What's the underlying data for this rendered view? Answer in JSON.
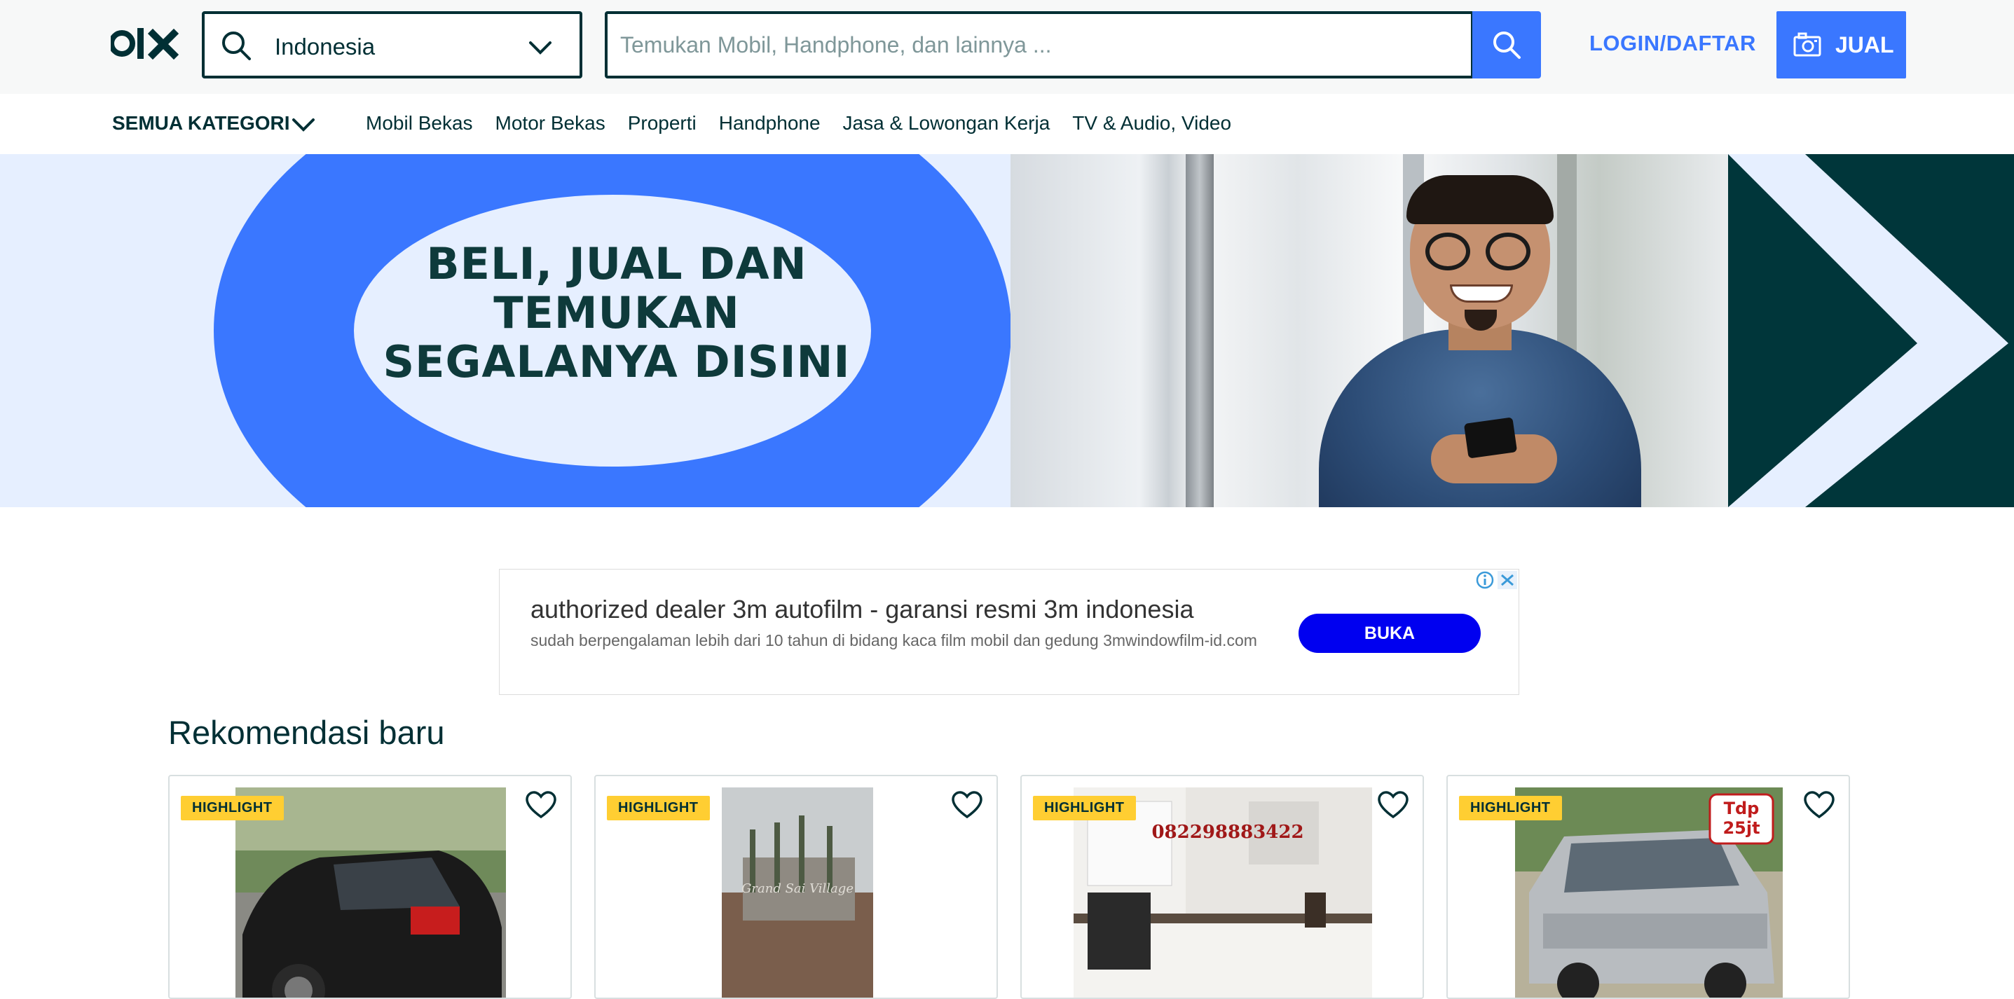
{
  "header": {
    "logo_alt": "olx",
    "location": "Indonesia",
    "search_placeholder": "Temukan Mobil, Handphone, dan lainnya ...",
    "login_label": "LOGIN/DAFTAR",
    "sell_label": "JUAL"
  },
  "categories": {
    "all_label": "SEMUA KATEGORI",
    "links": [
      "Mobil Bekas",
      "Motor Bekas",
      "Properti",
      "Handphone",
      "Jasa & Lowongan Kerja",
      "TV & Audio, Video"
    ]
  },
  "banner": {
    "headline_1": "BELI, JUAL DAN",
    "headline_2": "TEMUKAN",
    "headline_3": "SEGALANYA DISINI"
  },
  "ad": {
    "title": "authorized dealer 3m autofilm - garansi resmi 3m indonesia",
    "description": "sudah berpengalaman lebih dari 10 tahun di bidang kaca film mobil dan gedung 3mwindowfilm-id.com",
    "button": "BUKA"
  },
  "recommendations": {
    "title": "Rekomendasi baru",
    "cards": [
      {
        "badge": "HIGHLIGHT"
      },
      {
        "badge": "HIGHLIGHT",
        "image_text": "Grand Sai Village"
      },
      {
        "badge": "HIGHLIGHT",
        "image_text": "082298883422"
      },
      {
        "badge": "HIGHLIGHT",
        "image_text_1": "Tdp",
        "image_text_2": "25jt"
      }
    ]
  },
  "colors": {
    "brand_dark": "#002f34",
    "accent_blue": "#3a77ff",
    "badge_yellow": "#ffce32",
    "ad_button": "#0000f0"
  }
}
